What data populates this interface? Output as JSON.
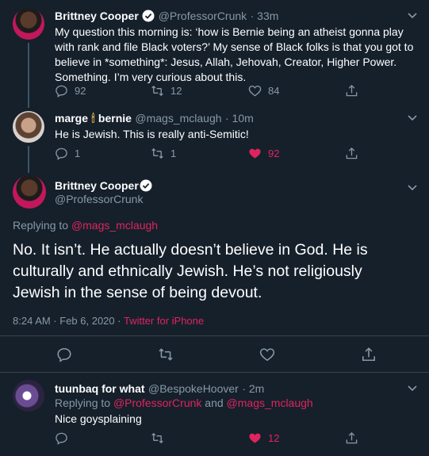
{
  "tweet1": {
    "name": "Brittney Cooper",
    "handle": "@ProfessorCrunk",
    "time": "· 33m",
    "text": "My question this morning is: ‘how is Bernie being an atheist gonna play with rank and file Black voters?’ My sense of Black folks is that you got to believe in *something*: Jesus, Allah, Jehovah, Creator, Higher Power. Something. I’m very curious about this.",
    "replies": "92",
    "retweets": "12",
    "likes": "84"
  },
  "tweet2": {
    "name_part1": "marge",
    "name_emoji": "🕯",
    "name_part2": "bernie",
    "handle": "@mags_mclaugh",
    "time": "· 10m",
    "text": "He is Jewish. This is really anti-Semitic!",
    "replies": "1",
    "retweets": "1",
    "likes": "92"
  },
  "main": {
    "name": "Brittney Cooper",
    "handle": "@ProfessorCrunk",
    "replying_prefix": "Replying to ",
    "replying_to": "@mags_mclaugh",
    "text": "No. It isn’t. He actually doesn’t believe in God. He is culturally and ethnically Jewish. He’s not religiously Jewish in the sense of being devout.",
    "timestamp": "8:24 AM · Feb 6, 2020 · ",
    "source": "Twitter for iPhone"
  },
  "tweet3": {
    "name": "tuunbaq for what",
    "handle": "@BespokeHoover",
    "time": "· 2m",
    "replying_prefix": "Replying to ",
    "replying_to_1": "@ProfessorCrunk",
    "replying_and": " and ",
    "replying_to_2": "@mags_mclaugh",
    "text": "Nice goysplaining",
    "likes": "12"
  },
  "colors": {
    "background": "#15202b",
    "muted": "#8899a6",
    "accent_link": "#e0245e",
    "liked": "#e0245e",
    "divider": "#38444d"
  }
}
